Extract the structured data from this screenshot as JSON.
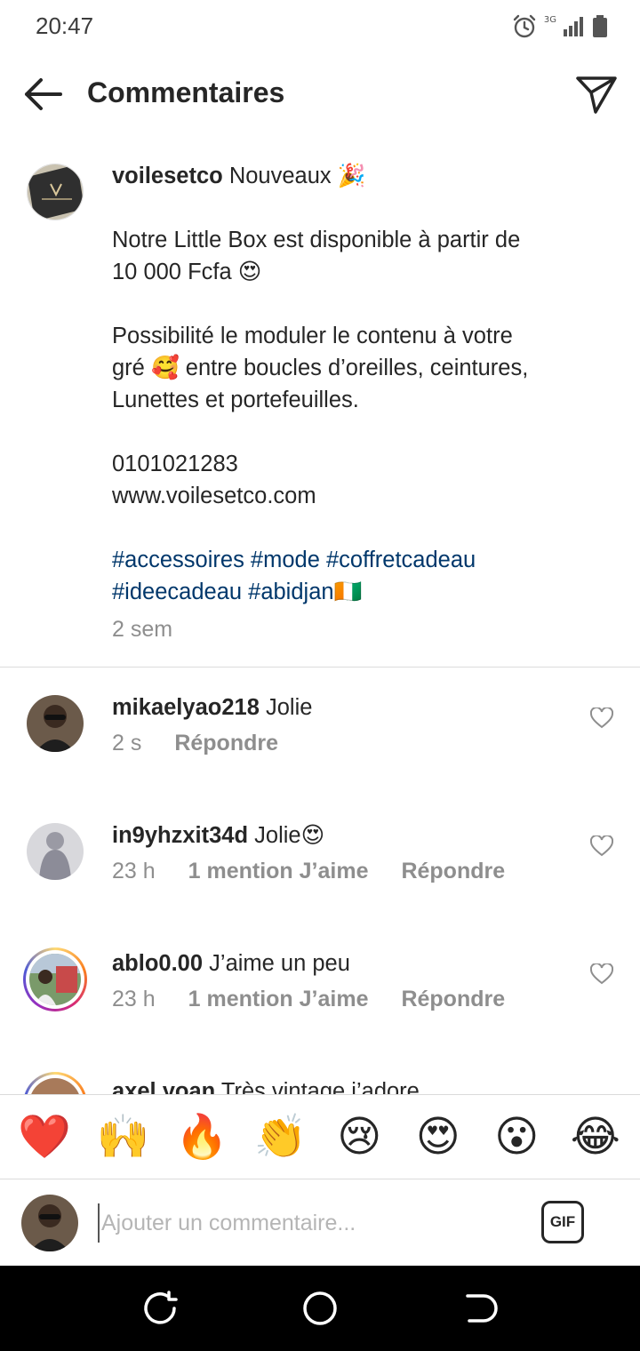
{
  "status_bar": {
    "time": "20:47",
    "network": "3G",
    "icons": [
      "alarm-icon",
      "signal-icon",
      "battery-icon"
    ]
  },
  "header": {
    "title": "Commentaires",
    "back_icon": "arrow-left-icon",
    "share_icon": "paper-plane-icon"
  },
  "caption": {
    "username": "voilesetco",
    "lines": [
      "Nouveaux 🎉",
      "",
      "Notre Little Box est disponible à partir de",
      "10 000 Fcfa 😍",
      "",
      "Possibilité le moduler le contenu à votre",
      "gré 🥰 entre boucles d’oreilles, ceintures,",
      "Lunettes et portefeuilles.",
      "",
      "0101021283",
      "www.voilesetco.com",
      ""
    ],
    "hashtags_line1": "#accessoires #mode #coffretcadeau",
    "hashtags_line2": "#ideecadeau #abidjan🇨🇮",
    "time_ago": "2 sem"
  },
  "comments": [
    {
      "username": "mikaelyao218",
      "text": "Jolie",
      "time": "2 s",
      "likes": "",
      "reply": "Répondre"
    },
    {
      "username": "in9yhzxit34d",
      "text": "Jolie😍",
      "time": "23 h",
      "likes": "1 mention J’aime",
      "reply": "Répondre"
    },
    {
      "username": "ablo0.00",
      "text": "J’aime un peu",
      "time": "23 h",
      "likes": "1 mention J’aime",
      "reply": "Répondre"
    },
    {
      "username": "axel.yoan",
      "text": "Très vintage j’adore",
      "time": "",
      "likes": "",
      "reply": ""
    }
  ],
  "emoji_bar": [
    "❤️",
    "🙌",
    "🔥",
    "👏",
    "😢",
    "😍",
    "😮",
    "😂"
  ],
  "composer": {
    "placeholder": "Ajouter un commentaire...",
    "gif_label": "GIF"
  },
  "colors": {
    "hashtag": "#00376b",
    "secondary_text": "#8e8e8e",
    "divider": "#dbdbdb"
  }
}
